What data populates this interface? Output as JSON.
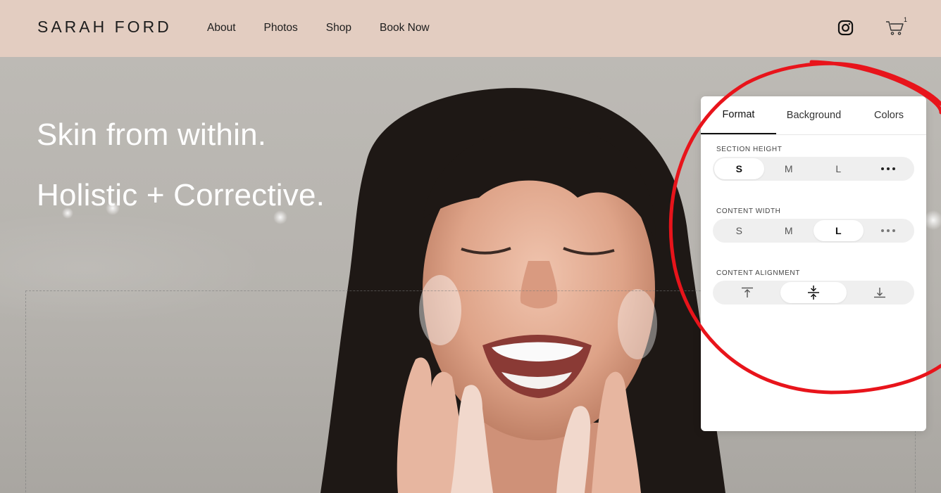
{
  "brand": "SARAH FORD",
  "nav": [
    "About",
    "Photos",
    "Shop",
    "Book Now"
  ],
  "header": {
    "instagram_icon": "instagram-icon",
    "cart_icon": "cart-icon",
    "cart_count": "1"
  },
  "hero": {
    "line1": "Skin from within.",
    "line2": "Holistic + Corrective."
  },
  "panel": {
    "tabs": [
      "Format",
      "Background",
      "Colors"
    ],
    "active_tab": "Format",
    "section_height": {
      "label": "SECTION HEIGHT",
      "options": [
        "S",
        "M",
        "L"
      ],
      "selected": "S"
    },
    "content_width": {
      "label": "CONTENT WIDTH",
      "options": [
        "S",
        "M",
        "L"
      ],
      "selected": "L"
    },
    "content_alignment": {
      "label": "CONTENT ALIGNMENT",
      "options": [
        "align-top-icon",
        "align-center-icon",
        "align-bottom-icon"
      ],
      "selected": "align-center-icon"
    }
  },
  "colors": {
    "header_bg": "#e3cdc1",
    "annotation": "#e8141b",
    "panel_bg": "#ffffff"
  }
}
